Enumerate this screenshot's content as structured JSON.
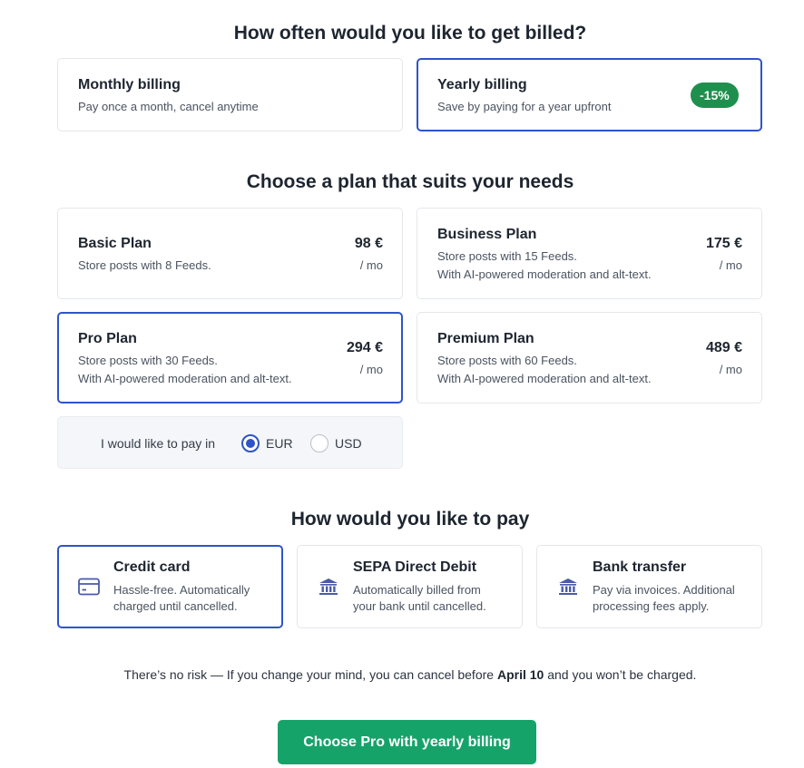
{
  "billing": {
    "heading": "How often would you like to get billed?",
    "monthly": {
      "title": "Monthly billing",
      "subtitle": "Pay once a month, cancel anytime"
    },
    "yearly": {
      "title": "Yearly billing",
      "subtitle": "Save by paying for a year upfront",
      "badge": "-15%"
    }
  },
  "plans": {
    "heading": "Choose a plan that suits your needs",
    "basic": {
      "title": "Basic Plan",
      "line1": "Store posts with 8 Feeds.",
      "price": "98 €",
      "period": "/ mo"
    },
    "business": {
      "title": "Business Plan",
      "line1": "Store posts with 15 Feeds.",
      "line2": "With AI-powered moderation and alt-text.",
      "price": "175 €",
      "period": "/ mo"
    },
    "pro": {
      "title": "Pro Plan",
      "line1": "Store posts with 30 Feeds.",
      "line2": "With AI-powered moderation and alt-text.",
      "price": "294 €",
      "period": "/ mo"
    },
    "premium": {
      "title": "Premium Plan",
      "line1": "Store posts with 60 Feeds.",
      "line2": "With AI-powered moderation and alt-text.",
      "price": "489 €",
      "period": "/ mo"
    }
  },
  "currency": {
    "label": "I would like to pay in",
    "options": [
      "EUR",
      "USD"
    ],
    "selected": "EUR"
  },
  "payment": {
    "heading": "How would you like to pay",
    "credit_card": {
      "title": "Credit card",
      "line1": "Hassle-free. Automatically",
      "line2": "charged until cancelled."
    },
    "sepa": {
      "title": "SEPA Direct Debit",
      "line1": "Automatically billed from",
      "line2": "your bank until cancelled."
    },
    "bank": {
      "title": "Bank transfer",
      "line1": "Pay via invoices. Additional",
      "line2": "processing fees apply."
    }
  },
  "note": {
    "before": "There’s no risk — If you change your mind, you can cancel before ",
    "date": "April 10",
    "after": " and you won’t be charged."
  },
  "cta": {
    "label": "Choose Pro with yearly billing"
  },
  "colors": {
    "accent": "#2f54c9",
    "badge": "#1f8f4e",
    "cta": "#16a36a"
  }
}
